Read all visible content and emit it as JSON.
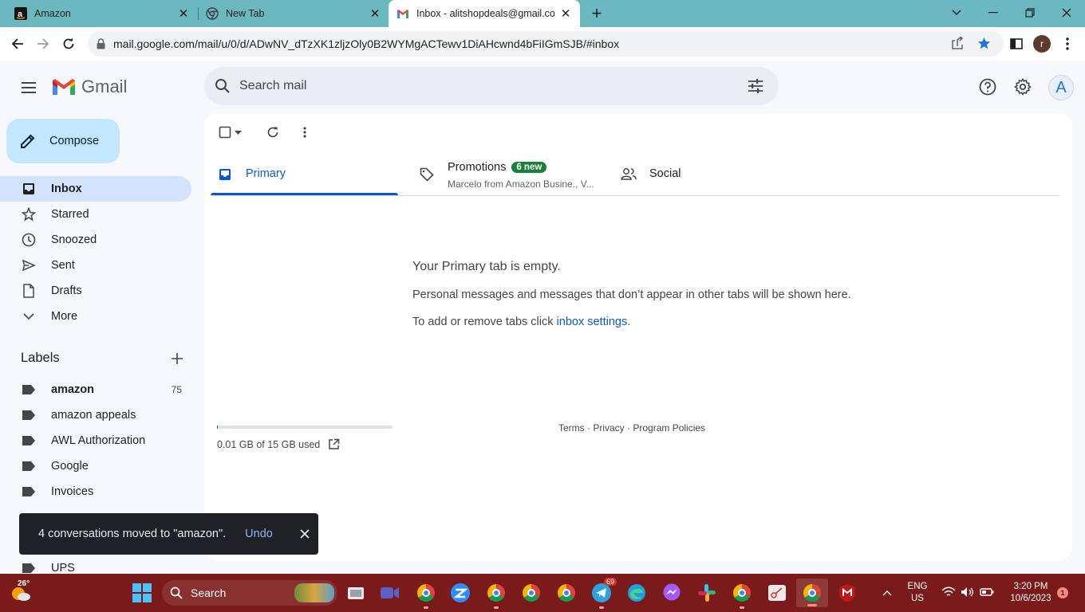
{
  "browser": {
    "tabs": [
      {
        "title": "Amazon",
        "favicon": "amazon-icon"
      },
      {
        "title": "New Tab",
        "favicon": "chrome-icon"
      },
      {
        "title": "Inbox - alitshopdeals@gmail.com",
        "favicon": "gmail-icon",
        "active": true
      }
    ],
    "url": "mail.google.com/mail/u/0/d/ADwNV_dTzXK1zljzOly0B2WYMgACTewv1DiAHcwnd4bFiIGmSJB/#inbox",
    "profile_initial": "r"
  },
  "gmail": {
    "logo_text": "Gmail",
    "search_placeholder": "Search mail",
    "account_initial": "A",
    "compose_label": "Compose",
    "nav": [
      {
        "label": "Inbox",
        "icon": "inbox-icon",
        "active": true
      },
      {
        "label": "Starred",
        "icon": "star-icon"
      },
      {
        "label": "Snoozed",
        "icon": "clock-icon"
      },
      {
        "label": "Sent",
        "icon": "send-icon"
      },
      {
        "label": "Drafts",
        "icon": "draft-icon"
      },
      {
        "label": "More",
        "icon": "chevron-down-icon"
      }
    ],
    "labels_heading": "Labels",
    "labels": [
      {
        "name": "amazon",
        "count": "75",
        "bold": true
      },
      {
        "name": "amazon appeals"
      },
      {
        "name": "AWL Authorization"
      },
      {
        "name": "Google"
      },
      {
        "name": "Invoices"
      },
      {
        "name": "UPS"
      }
    ],
    "category_tabs": {
      "primary": "Primary",
      "promotions": "Promotions",
      "promotions_badge": "6 new",
      "promotions_sub": "Marcelo from Amazon Busine., V...",
      "social": "Social"
    },
    "empty": {
      "title": "Your Primary tab is empty.",
      "description": "Personal messages and messages that don’t appear in other tabs will be shown here.",
      "tabs_prefix": "To add or remove tabs click ",
      "tabs_link": "inbox settings",
      "tabs_suffix": "."
    },
    "storage": {
      "text": "0.01 GB of 15 GB used",
      "fraction": 0.0007
    },
    "footer": {
      "terms": "Terms",
      "privacy": "Privacy",
      "policies": "Program Policies",
      "sep": " · "
    },
    "snackbar": {
      "message": "4 conversations moved to \"amazon\".",
      "action": "Undo"
    }
  },
  "taskbar": {
    "weather_temp": "26°",
    "search_label": "Search",
    "telegram_badge": "69",
    "lang": "ENG",
    "region": "US",
    "time": "3:20 PM",
    "date": "10/6/2023",
    "notification_count": "1"
  },
  "colors": {
    "accent": "#0b57d0",
    "compose": "#c2e7ff",
    "nav_active": "#d3e3fd",
    "badge": "#188038",
    "taskbar": "#7a1a1a",
    "tabstrip": "#6cb8c1"
  }
}
